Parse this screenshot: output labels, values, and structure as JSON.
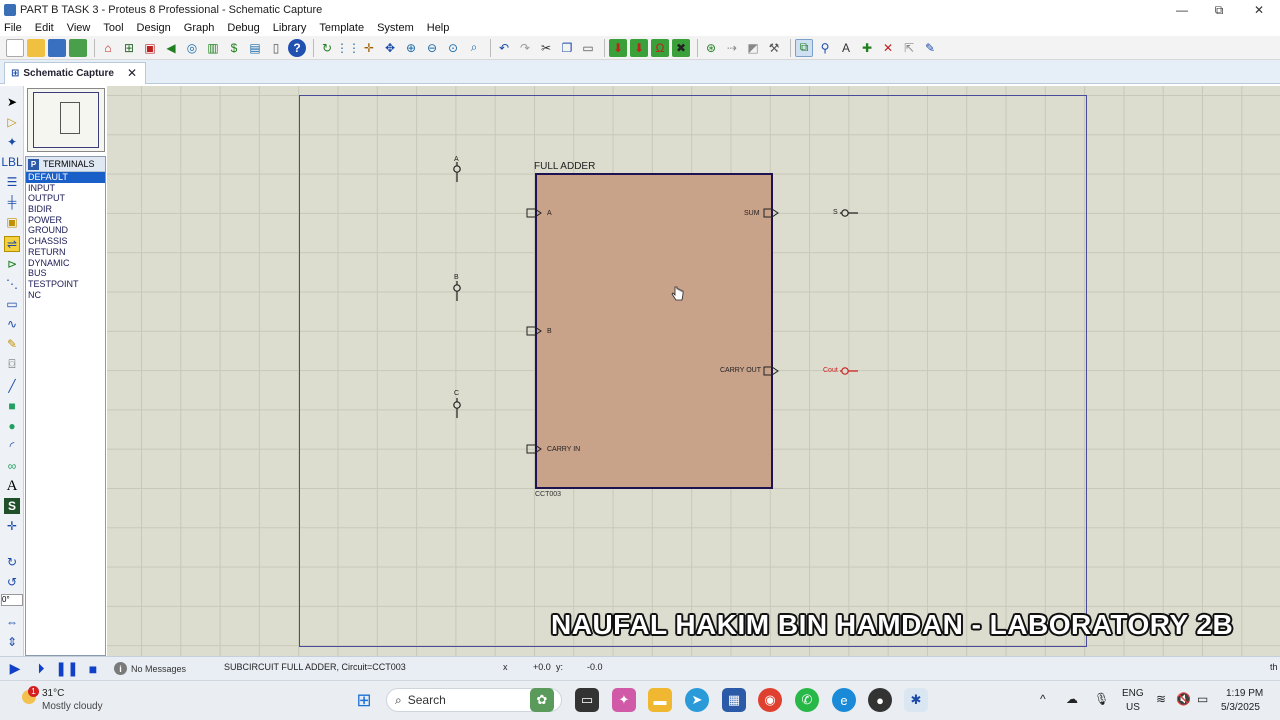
{
  "window": {
    "title": "PART B TASK 3 - Proteus 8 Professional - Schematic Capture",
    "minimize": "—",
    "restore": "⧉",
    "close": "✕"
  },
  "menu": [
    "File",
    "Edit",
    "View",
    "Tool",
    "Design",
    "Graph",
    "Debug",
    "Library",
    "Template",
    "System",
    "Help"
  ],
  "tab": {
    "label": "Schematic Capture",
    "close": "✕"
  },
  "terminals": {
    "header": "TERMINALS",
    "badge": "P",
    "items": [
      "DEFAULT",
      "INPUT",
      "OUTPUT",
      "BIDIR",
      "POWER",
      "GROUND",
      "CHASSIS",
      "RETURN",
      "DYNAMIC",
      "BUS",
      "TESTPOINT",
      "NC"
    ],
    "selected": "DEFAULT"
  },
  "rotation_value": "0°",
  "schematic": {
    "block_title": "FULL ADDER",
    "block_ref": "CCT003",
    "pins_left": [
      "A",
      "B",
      "CARRY IN"
    ],
    "pins_right": [
      "SUM",
      "CARRY OUT"
    ],
    "input_terminals": [
      "A",
      "B",
      "C"
    ],
    "output_terminals": [
      "S",
      "Cout"
    ],
    "block_fill": "#c9a28a",
    "block_border": "#1e1250",
    "cout_color": "#cc2222"
  },
  "watermark": "NAUFAL HAKIM BIN HAMDAN - LABORATORY 2B",
  "status": {
    "messages": "No Messages",
    "selection": "SUBCIRCUIT FULL ADDER, Circuit=CCT003",
    "x_label": "x",
    "x_value": "+0.0",
    "y_label": "y:",
    "y_value": "-0.0",
    "units": "th"
  },
  "taskbar": {
    "weather_badge": "1",
    "temperature": "31°C",
    "condition": "Mostly cloudy",
    "search_placeholder": "Search",
    "language": "ENG",
    "region": "US",
    "time": "1:19 PM",
    "date": "5/3/2025"
  }
}
